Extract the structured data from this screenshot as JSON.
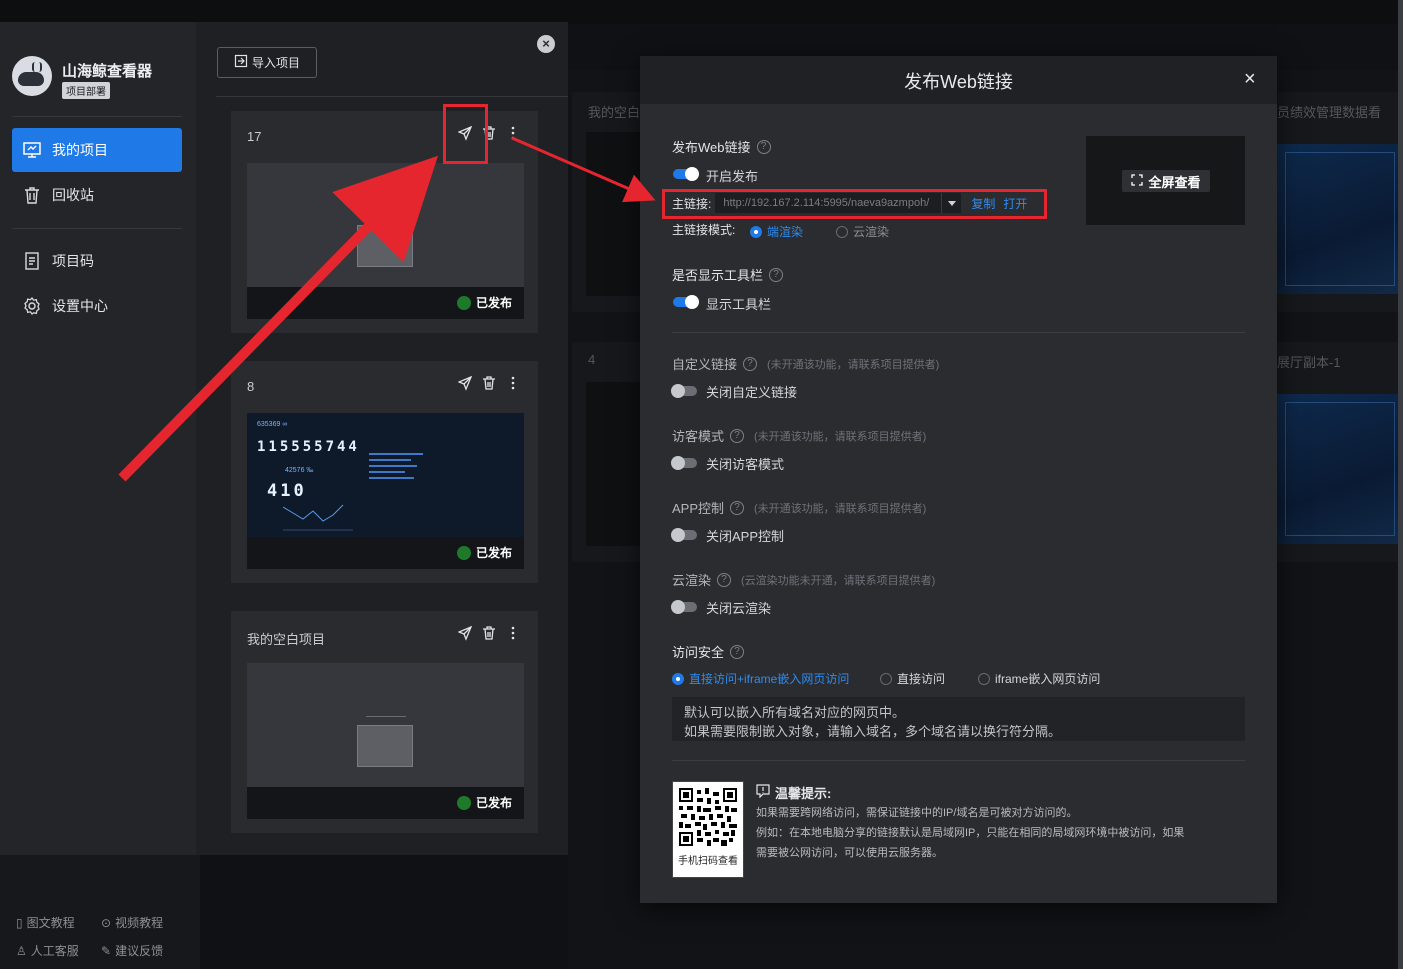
{
  "app": {
    "title": "山海鲸查看器",
    "badge": "项目部署"
  },
  "sidebar": {
    "items": [
      {
        "label": "我的项目",
        "icon": "monitor-icon",
        "active": true
      },
      {
        "label": "回收站",
        "icon": "trash-icon",
        "active": false
      },
      {
        "label": "项目码",
        "icon": "document-icon",
        "active": false
      },
      {
        "label": "设置中心",
        "icon": "gear-icon",
        "active": false
      }
    ],
    "footer": [
      {
        "label": "图文教程",
        "icon": "book-icon"
      },
      {
        "label": "视频教程",
        "icon": "play-icon"
      },
      {
        "label": "人工客服",
        "icon": "user-icon"
      },
      {
        "label": "建议反馈",
        "icon": "feedback-icon"
      }
    ]
  },
  "toolbar": {
    "import_label": "导入项目"
  },
  "projects": [
    {
      "name": "17",
      "status": "已发布"
    },
    {
      "name": "8",
      "status": "已发布",
      "dash": {
        "top": "635369 ∞",
        "big": "115555744",
        "sub": "42576 ‰",
        "mid": "410"
      }
    },
    {
      "name": "我的空白项目",
      "status": "已发布"
    }
  ],
  "background": {
    "card_titles": [
      "我的空白",
      "员绩效管理数据看",
      "4",
      "展厅副本-1"
    ]
  },
  "modal": {
    "title": "发布Web链接",
    "close": "×",
    "publish": {
      "label": "发布Web链接",
      "toggle_label": "开启发布",
      "on": true
    },
    "main_link": {
      "key": "主链接:",
      "value": "http://192.167.2.114:5995/naeva9azmpoh/",
      "copy": "复制",
      "open": "打开"
    },
    "mode": {
      "key": "主链接模式:",
      "options": [
        "端渲染",
        "云渲染"
      ],
      "selected": 0
    },
    "fullscreen": "全屏查看",
    "toolbar_show": {
      "label": "是否显示工具栏",
      "toggle_label": "显示工具栏",
      "on": true
    },
    "custom_link": {
      "label": "自定义链接",
      "note": "(未开通该功能，请联系项目提供者)",
      "toggle_label": "关闭自定义链接"
    },
    "guest": {
      "label": "访客模式",
      "note": "(未开通该功能，请联系项目提供者)",
      "toggle_label": "关闭访客模式"
    },
    "app_ctrl": {
      "label": "APP控制",
      "note": "(未开通该功能，请联系项目提供者)",
      "toggle_label": "关闭APP控制"
    },
    "cloud": {
      "label": "云渲染",
      "note": "(云渲染功能未开通，请联系项目提供者)",
      "toggle_label": "关闭云渲染"
    },
    "security": {
      "label": "访问安全",
      "options": [
        "直接访问+iframe嵌入网页访问",
        "直接访问",
        "iframe嵌入网页访问"
      ],
      "selected": 0,
      "hint_line1": "默认可以嵌入所有域名对应的网页中。",
      "hint_line2": "如果需要限制嵌入对象，请输入域名，多个域名请以换行符分隔。"
    },
    "qr_caption": "手机扫码查看",
    "tips": {
      "title": "温馨提示:",
      "line1": "如果需要跨网络访问，需保证链接中的IP/域名是可被对方访问的。",
      "line2": "例如：在本地电脑分享的链接默认是局域网IP，只能在相同的局域网环境中被访问，如果",
      "line3": "需要被公网访问，可以使用云服务器。"
    }
  },
  "colors": {
    "accent": "#1f7ae8",
    "link": "#2d8cf0",
    "highlight": "#e5262f",
    "published": "#1e7a2a"
  }
}
